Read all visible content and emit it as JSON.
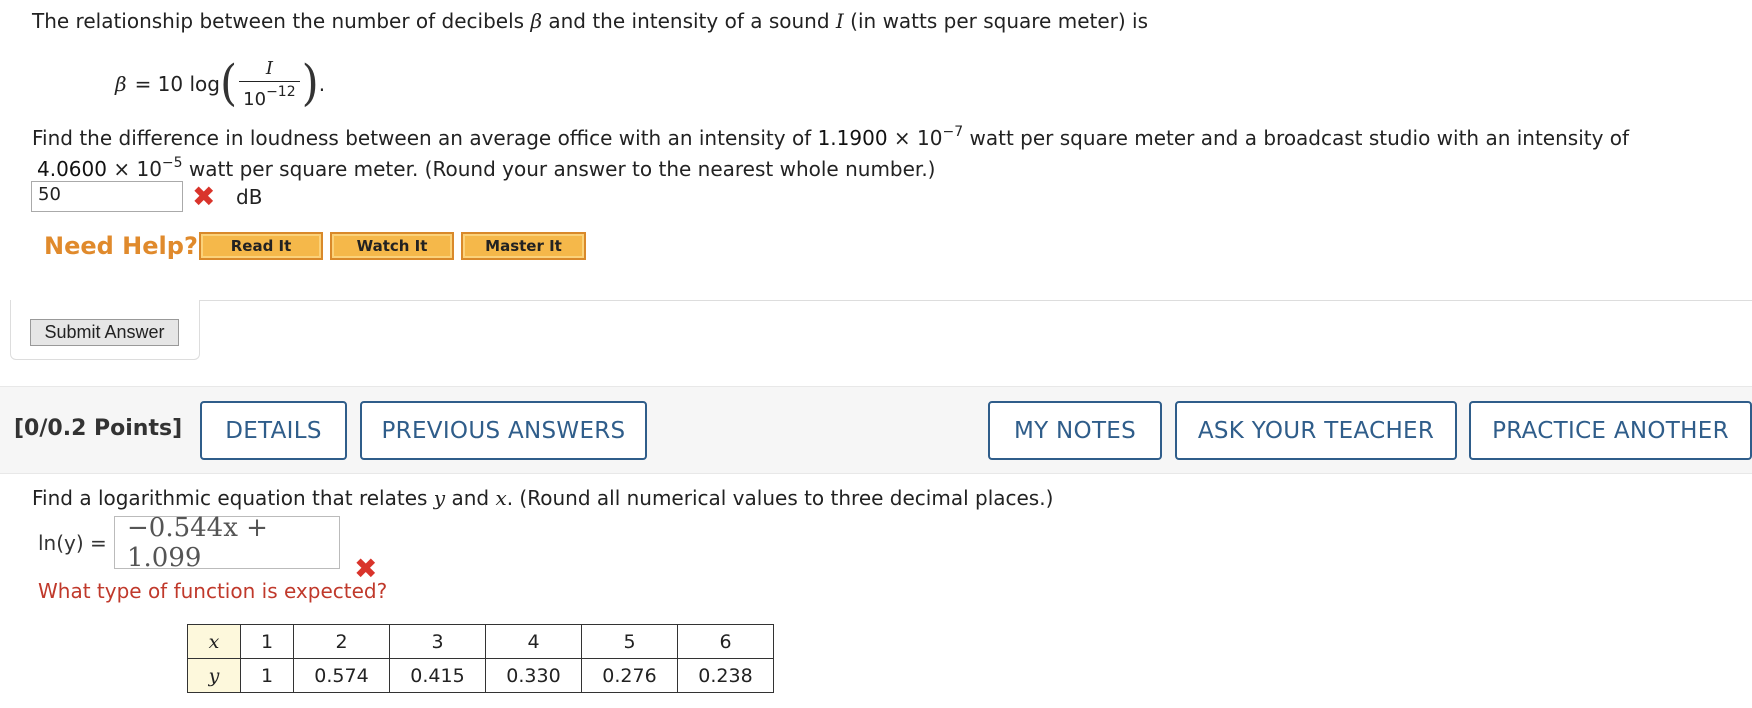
{
  "problem1": {
    "intro": "The relationship between the number of decibels β and the intensity of a sound I (in watts per square meter) is",
    "intro_parts": {
      "a": "The relationship between the number of decibels ",
      "beta": "β",
      "b": " and the intensity of a sound ",
      "I": "I",
      "c": " (in watts per square meter) is"
    },
    "formula": {
      "lhs": "β",
      "eq": "= 10 log",
      "numerator": "I",
      "denominator_base": "10",
      "denominator_exp": "−12",
      "tail": "."
    },
    "question_line1": {
      "a": "Find the difference in loudness between an average office with an intensity of ",
      "value1_mantissa": "1.1900",
      "times": "×",
      "value1_base": "10",
      "value1_exp": "−7",
      "b": " watt per square meter and a broadcast studio with an intensity of"
    },
    "question_line2": {
      "value2_mantissa": "4.0600",
      "times": "×",
      "value2_base": "10",
      "value2_exp": "−5",
      "b": " watt per square meter. (Round your answer to the nearest whole number.)"
    },
    "answer_value": "50",
    "answer_unit": "dB",
    "need_help_label": "Need Help?",
    "help_buttons": [
      "Read It",
      "Watch It",
      "Master It"
    ],
    "submit_label": "Submit Answer"
  },
  "problem_bar": {
    "points": "[0/0.2 Points]",
    "buttons": [
      "DETAILS",
      "PREVIOUS ANSWERS",
      "MY NOTES",
      "ASK YOUR TEACHER",
      "PRACTICE ANOTHER"
    ]
  },
  "problem2": {
    "prompt": {
      "a": "Find a logarithmic equation that relates ",
      "y": "y",
      "b": " and ",
      "x": "x",
      "c": ". (Round all numerical values to three decimal places.)"
    },
    "eq_label": "ln(y) =",
    "eq_answer": "−0.544x + 1.099",
    "hint": "What type of function is expected?",
    "table": {
      "x_label": "x",
      "y_label": "y",
      "x": [
        "1",
        "2",
        "3",
        "4",
        "5",
        "6"
      ],
      "y": [
        "1",
        "0.574",
        "0.415",
        "0.330",
        "0.276",
        "0.238"
      ]
    }
  },
  "colors": {
    "error_red": "#d9342b",
    "help_orange": "#e08a2c",
    "button_blue": "#2f5d8a",
    "help_button_fill": "#f5b84a"
  }
}
